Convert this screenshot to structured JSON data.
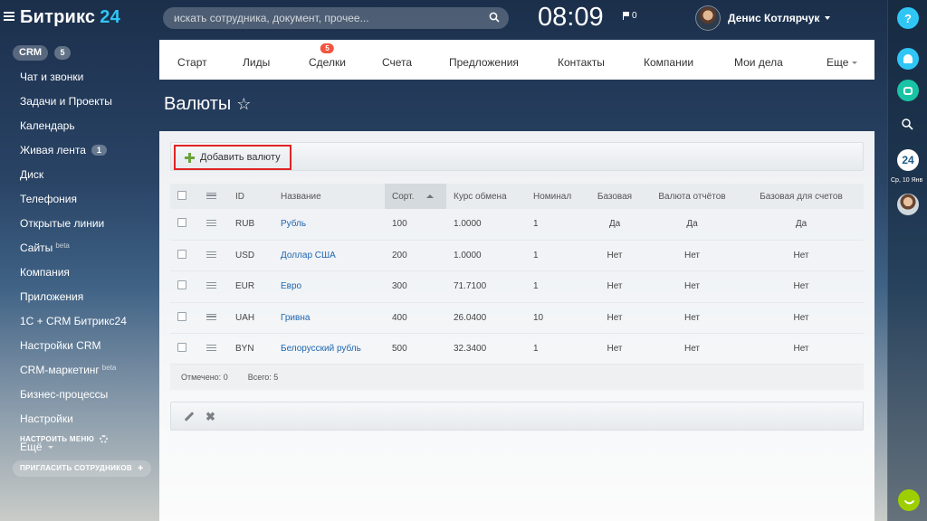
{
  "header": {
    "logo_main": "Битрикс",
    "logo_num": "24",
    "search_placeholder": "искать сотрудника, документ, прочее...",
    "clock": "08:09",
    "flag_count": "0",
    "user_name": "Денис Котлярчук"
  },
  "sidebar": {
    "crm_label": "CRM",
    "crm_count": "5",
    "items": [
      {
        "label": "Чат и звонки"
      },
      {
        "label": "Задачи и Проекты"
      },
      {
        "label": "Календарь"
      },
      {
        "label": "Живая лента",
        "count": "1"
      },
      {
        "label": "Диск"
      },
      {
        "label": "Телефония"
      },
      {
        "label": "Открытые линии"
      },
      {
        "label": "Сайты",
        "beta": "beta"
      },
      {
        "label": "Компания"
      },
      {
        "label": "Приложения"
      },
      {
        "label": "1С + CRM Битрикс24"
      },
      {
        "label": "Настройки CRM"
      },
      {
        "label": "CRM-маркетинг",
        "beta": "beta"
      },
      {
        "label": "Бизнес-процессы"
      },
      {
        "label": "Настройки"
      },
      {
        "label": "Ещё"
      }
    ],
    "configure_label": "НАСТРОИТЬ МЕНЮ",
    "invite_label": "ПРИГЛАСИТЬ СОТРУДНИКОВ"
  },
  "rightbar": {
    "help": "?",
    "logo": "24",
    "date": "Ср, 10 Янв"
  },
  "tabs": [
    {
      "label": "Старт"
    },
    {
      "label": "Лиды"
    },
    {
      "label": "Сделки",
      "badge": "5"
    },
    {
      "label": "Счета"
    },
    {
      "label": "Предложения"
    },
    {
      "label": "Контакты"
    },
    {
      "label": "Компании"
    },
    {
      "label": "Мои дела"
    },
    {
      "label": "Еще"
    }
  ],
  "page": {
    "title": "Валюты",
    "add_button": "Добавить валюту"
  },
  "table": {
    "columns": {
      "id": "ID",
      "name": "Название",
      "sort": "Сорт.",
      "rate": "Курс обмена",
      "nominal": "Номинал",
      "base": "Базовая",
      "report": "Валюта отчётов",
      "invoice_base": "Базовая для счетов"
    },
    "rows": [
      {
        "id": "RUB",
        "name": "Рубль",
        "sort": "100",
        "rate": "1.0000",
        "nominal": "1",
        "base": "Да",
        "report": "Да",
        "invoice_base": "Да"
      },
      {
        "id": "USD",
        "name": "Доллар США",
        "sort": "200",
        "rate": "1.0000",
        "nominal": "1",
        "base": "Нет",
        "report": "Нет",
        "invoice_base": "Нет"
      },
      {
        "id": "EUR",
        "name": "Евро",
        "sort": "300",
        "rate": "71.7100",
        "nominal": "1",
        "base": "Нет",
        "report": "Нет",
        "invoice_base": "Нет"
      },
      {
        "id": "UAH",
        "name": "Гривна",
        "sort": "400",
        "rate": "26.0400",
        "nominal": "10",
        "base": "Нет",
        "report": "Нет",
        "invoice_base": "Нет"
      },
      {
        "id": "BYN",
        "name": "Белорусский рубль",
        "sort": "500",
        "rate": "32.3400",
        "nominal": "1",
        "base": "Нет",
        "report": "Нет",
        "invoice_base": "Нет"
      }
    ],
    "footer_selected": "Отмечено: 0",
    "footer_total": "Всего: 5"
  }
}
